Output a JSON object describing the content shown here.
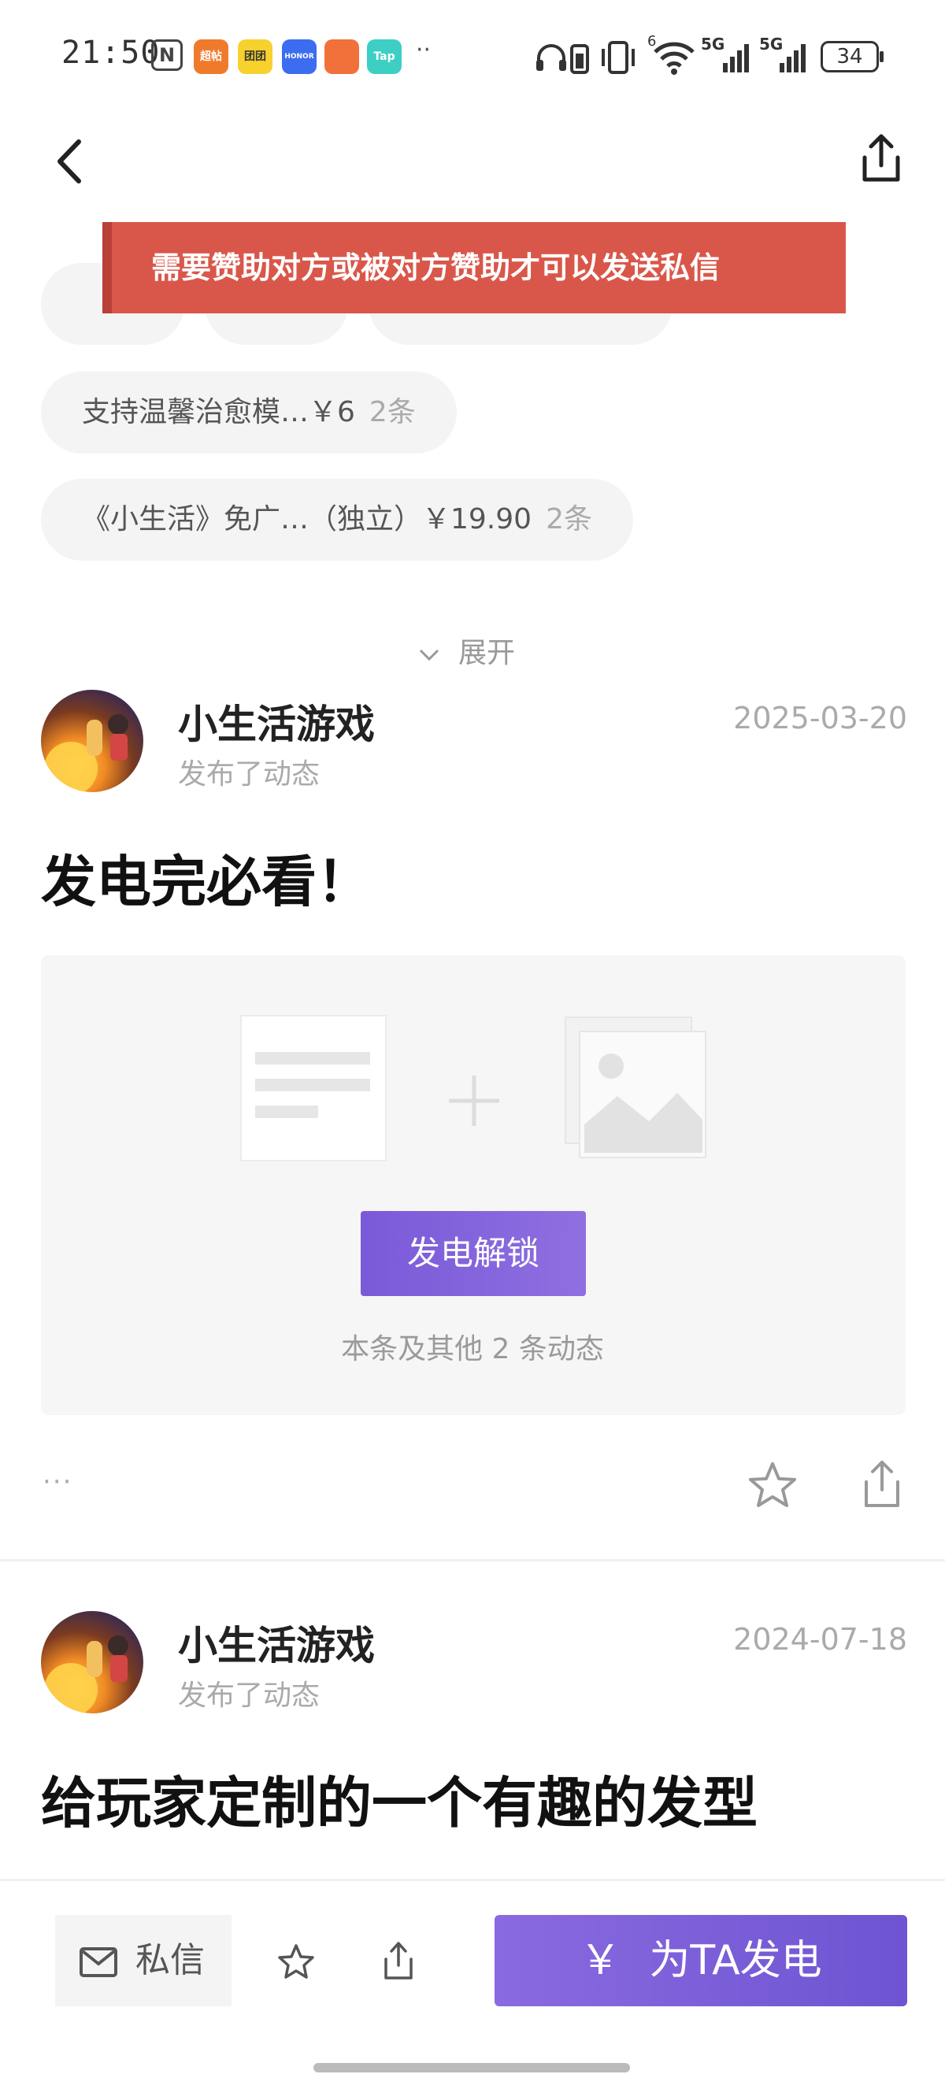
{
  "status_bar": {
    "time": "21:50",
    "apps": [
      {
        "label": "超帖",
        "color": "#f07a2c"
      },
      {
        "label": "团团",
        "color": "#f7d12e"
      },
      {
        "label": "HONOR",
        "color": "#3c6df0"
      },
      {
        "label": "",
        "color": "#f2703a"
      },
      {
        "label": "Tap",
        "color": "#3ecfc4"
      }
    ],
    "more": "··",
    "battery": "34",
    "signal1": "5G",
    "signal2": "5G",
    "wifi_label": "6"
  },
  "header": {
    "back_icon": "back-arrow-icon",
    "share_icon": "share-icon"
  },
  "banner": {
    "text": "需要赞助对方或被对方赞助才可以发送私信"
  },
  "chips": [
    {
      "label": "支持温馨治愈模…￥6",
      "count": "2条"
    },
    {
      "label": "《小生活》免广…（独立）￥19.90",
      "count": "2条"
    }
  ],
  "expand": {
    "label": "展开"
  },
  "posts": [
    {
      "author": "小生活游戏",
      "action": "发布了动态",
      "date": "2025-03-20",
      "title": "发电完必看！",
      "unlock_label": "发电解锁",
      "locked_desc": "本条及其他 2 条动态"
    },
    {
      "author": "小生活游戏",
      "action": "发布了动态",
      "date": "2024-07-18",
      "title": "给玩家定制的一个有趣的发型"
    }
  ],
  "post_actions": {
    "more": "···"
  },
  "bottom_bar": {
    "dm_label": "私信",
    "support_label": "为TA发电",
    "support_currency": "￥"
  },
  "colors": {
    "accent": "#7a5ad8",
    "banner": "#d9574a"
  }
}
